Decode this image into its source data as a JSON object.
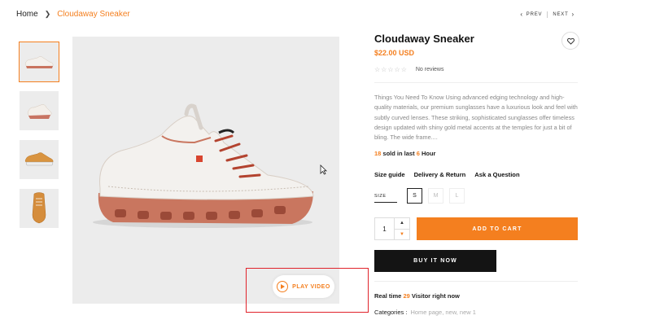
{
  "breadcrumb": {
    "home": "Home",
    "separator": "❯",
    "current": "Cloudaway Sneaker"
  },
  "pager": {
    "prev_label": "PREV",
    "next_label": "NEXT"
  },
  "thumbnails": [
    {
      "icon": "sneaker-side-view"
    },
    {
      "icon": "sneaker-angle-view"
    },
    {
      "icon": "sneaker-tan-side-view"
    },
    {
      "icon": "sneaker-back-view"
    }
  ],
  "media": {
    "play_video_label": "PLAY VIDEO"
  },
  "product": {
    "title": "Cloudaway Sneaker",
    "price": "$22.00 USD",
    "stars": "☆☆☆☆☆",
    "reviews": "No reviews",
    "description": "Things You Need To Know Using advanced edging technology and high-quality materials, our premium sunglasses have a luxurious look and feel with subtly curved lenses. These striking, sophisticated sunglasses offer timeless design updated with shiny gold metal accents at the temples for just a bit of bling. The wide frame....",
    "sold": {
      "count": "18",
      "text1": " sold in last ",
      "hours": "6",
      "text2": " Hour"
    },
    "links": [
      "Size guide",
      "Delivery & Return",
      "Ask a Question"
    ],
    "size_label": "SIZE",
    "sizes": [
      "S",
      "M",
      "L"
    ],
    "selected_size": "S",
    "quantity": "1",
    "add_to_cart": "ADD TO CART",
    "buy_now": "BUY IT NOW",
    "visitors": {
      "prefix": "Real time ",
      "count": "29",
      "suffix": " Visitor right now"
    },
    "categories_label": "Categories :",
    "categories_value": "Home page, new, new 1"
  },
  "colors": {
    "accent": "#f47f1f",
    "dark": "#141414",
    "highlight": "#e0232b"
  }
}
